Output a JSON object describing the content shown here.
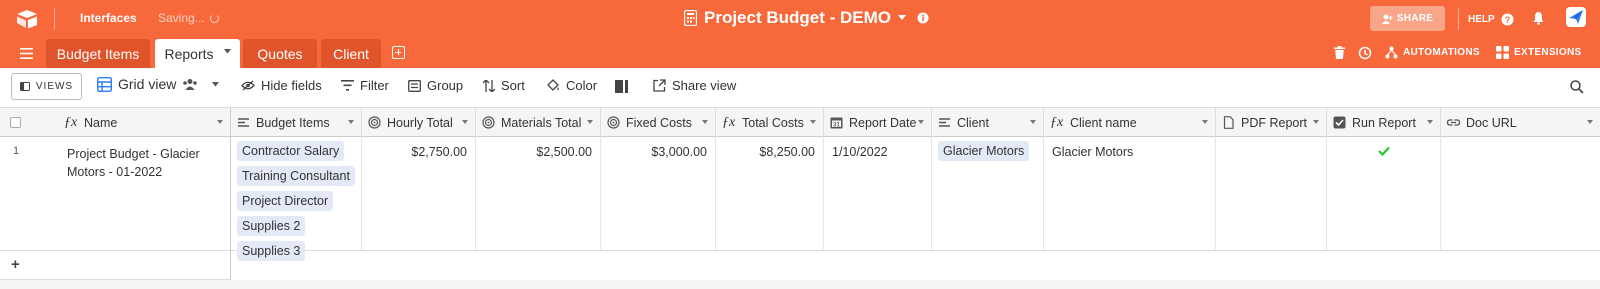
{
  "header": {
    "interfaces": "Interfaces",
    "saving": "Saving...",
    "base_title": "Project Budget - DEMO",
    "share": "SHARE",
    "help": "HELP"
  },
  "tabs": [
    {
      "label": "Budget Items",
      "active": false
    },
    {
      "label": "Reports",
      "active": true
    },
    {
      "label": "Quotes",
      "active": false
    },
    {
      "label": "Client",
      "active": false
    }
  ],
  "rightnav": {
    "automations": "AUTOMATIONS",
    "extensions": "EXTENSIONS"
  },
  "toolbar": {
    "views": "VIEWS",
    "view_name": "Grid view",
    "hide_fields": "Hide fields",
    "filter": "Filter",
    "group": "Group",
    "sort": "Sort",
    "color": "Color",
    "share_view": "Share view"
  },
  "columns": [
    {
      "label": "Name",
      "icon": "formula-icon"
    },
    {
      "label": "Budget Items",
      "icon": "link-icon"
    },
    {
      "label": "Hourly Total",
      "icon": "rollup-icon"
    },
    {
      "label": "Materials Total",
      "icon": "rollup-icon"
    },
    {
      "label": "Fixed Costs",
      "icon": "rollup-icon"
    },
    {
      "label": "Total Costs",
      "icon": "formula-icon"
    },
    {
      "label": "Report Date",
      "icon": "calendar-icon"
    },
    {
      "label": "Client",
      "icon": "link-icon"
    },
    {
      "label": "Client name",
      "icon": "formula-icon"
    },
    {
      "label": "PDF Report",
      "icon": "attachment-icon"
    },
    {
      "label": "Run Report",
      "icon": "checkbox-icon"
    },
    {
      "label": "Doc URL",
      "icon": "url-icon"
    }
  ],
  "rows": [
    {
      "row_number": "1",
      "name": "Project Budget - Glacier Motors - 01-2022",
      "budget_items": [
        "Contractor Salary",
        "Training Consultant",
        "Project Director",
        "Supplies 2",
        "Supplies 3"
      ],
      "hourly_total": "$2,750.00",
      "materials_total": "$2,500.00",
      "fixed_costs": "$3,000.00",
      "total_costs": "$8,250.00",
      "report_date": "1/10/2022",
      "client": "Glacier Motors",
      "client_name": "Glacier Motors",
      "run_report": true
    }
  ],
  "add_row": "+",
  "colors": {
    "brand": "#f7693b",
    "pill": "#e3e9f7",
    "check": "#20c933"
  }
}
